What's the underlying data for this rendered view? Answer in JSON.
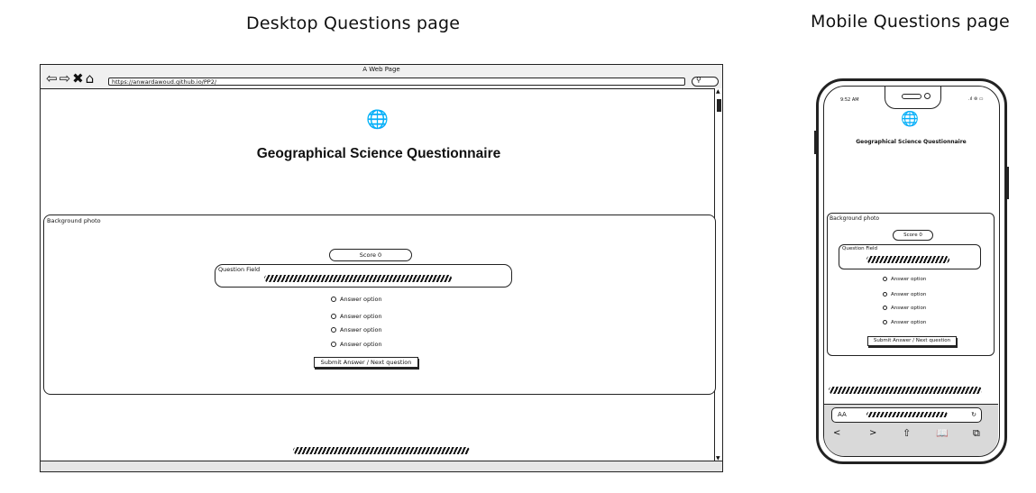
{
  "captions": {
    "desktop": "Desktop Questions page",
    "mobile": "Mobile Questions page"
  },
  "desktop": {
    "window_title": "A Web Page",
    "url": "https://anwardawoud.github.io/PP2/",
    "nav_icons": [
      "back-arrow-icon",
      "forward-arrow-icon",
      "close-icon",
      "home-icon"
    ],
    "page_title": "Geographical Science Questionnaire",
    "background_label": "Background photo",
    "score_label": "Score 0",
    "question_field_label": "Question Field",
    "answers": [
      "Answer option",
      "Answer option",
      "Answer option",
      "Answer option"
    ],
    "submit_label": "Submit Answer / Next question"
  },
  "mobile": {
    "status_time": "9:52 AM",
    "page_title": "Geographical Science Questionnaire",
    "background_label": "Background photo",
    "score_label": "Score 0",
    "question_field_label": "Question Field",
    "answers": [
      "Answer option",
      "Answer option",
      "Answer option",
      "Answer option"
    ],
    "submit_label": "Submit Answer / Next question",
    "text_size_label": "AA",
    "nav_chevrons": [
      "<",
      ">"
    ]
  }
}
